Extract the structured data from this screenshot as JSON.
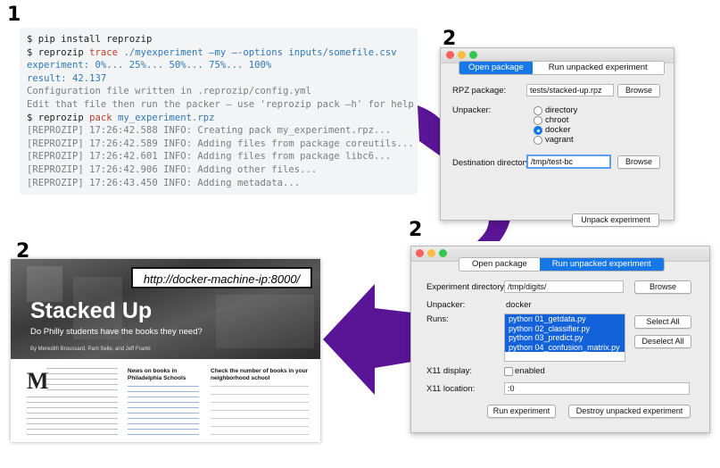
{
  "steps": {
    "one": "1",
    "two_a": "2",
    "two_b": "2",
    "two_c": "2"
  },
  "terminal": {
    "lines": [
      {
        "prompt": "$ ",
        "cmd": "pip install reprozip",
        "kw": "",
        "rest": ""
      },
      {
        "prompt": "$ ",
        "cmd": "reprozip ",
        "kw": "trace",
        "rest": " ./myexperiment –my —-options inputs/somefile.csv"
      },
      {
        "text": "experiment: 0%... 25%... 50%... 75%... 100%"
      },
      {
        "text": "result: 42.137"
      },
      {
        "text": "Configuration file written in .reprozip/config.yml"
      },
      {
        "text": "Edit that file then run the packer — use 'reprozip pack –h' for help"
      },
      {
        "prompt": "$ ",
        "cmd": "reprozip ",
        "kw": "pack",
        "rest": " my_experiment.rpz"
      },
      {
        "text": "[REPROZIP] 17:26:42.588 INFO: Creating pack my_experiment.rpz..."
      },
      {
        "text": "[REPROZIP] 17:26:42.589 INFO: Adding files from package coreutils..."
      },
      {
        "text": "[REPROZIP] 17:26:42.601 INFO: Adding files from package libc6..."
      },
      {
        "text": "[REPROZIP] 17:26:42.906 INFO: Adding other files..."
      },
      {
        "text": "[REPROZIP] 17:26:43.450 INFO: Adding metadata..."
      }
    ]
  },
  "unpack_window": {
    "tabs": [
      "Open package",
      "Run unpacked experiment"
    ],
    "rpz_label": "RPZ package:",
    "rpz_value": "tests/stacked-up.rpz",
    "browse": "Browse",
    "unpacker_label": "Unpacker:",
    "unpackers": [
      "directory",
      "chroot",
      "docker",
      "vagrant"
    ],
    "selected_unpacker": "docker",
    "dest_label": "Destination directory:",
    "dest_value": "/tmp/test-bc",
    "browse2": "Browse",
    "unpack_button": "Unpack experiment"
  },
  "run_window": {
    "tabs": [
      "Open package",
      "Run unpacked experiment"
    ],
    "exp_dir_label": "Experiment directory:",
    "exp_dir_value": "/tmp/digits/",
    "browse": "Browse",
    "unpacker_label": "Unpacker:",
    "unpacker_value": "docker",
    "runs_label": "Runs:",
    "runs": [
      "python 01_getdata.py",
      "python 02_classifier.py",
      "python 03_predict.py",
      "python 04_confusion_matrix.py"
    ],
    "select_all": "Select All",
    "deselect_all": "Deselect All",
    "x11_display_label": "X11 display:",
    "x11_enabled": "enabled",
    "x11_location_label": "X11 location:",
    "x11_location_value": ":0",
    "run_button": "Run experiment",
    "destroy_button": "Destroy unpacked experiment"
  },
  "webpage": {
    "url": "http://docker-machine-ip:8000/",
    "title": "Stacked Up",
    "subtitle": "Do Philly students have the books they need?",
    "authors": "By Meredith Broussard, Pam Selle, and Jeff Frankl",
    "dropcap": "M",
    "col2_heading": "News on books in Philadelphia Schools",
    "col3_heading": "Check the number of books in your neighborhood school"
  },
  "colors": {
    "arrow": "#5a1496",
    "accent": "#1877e6"
  }
}
